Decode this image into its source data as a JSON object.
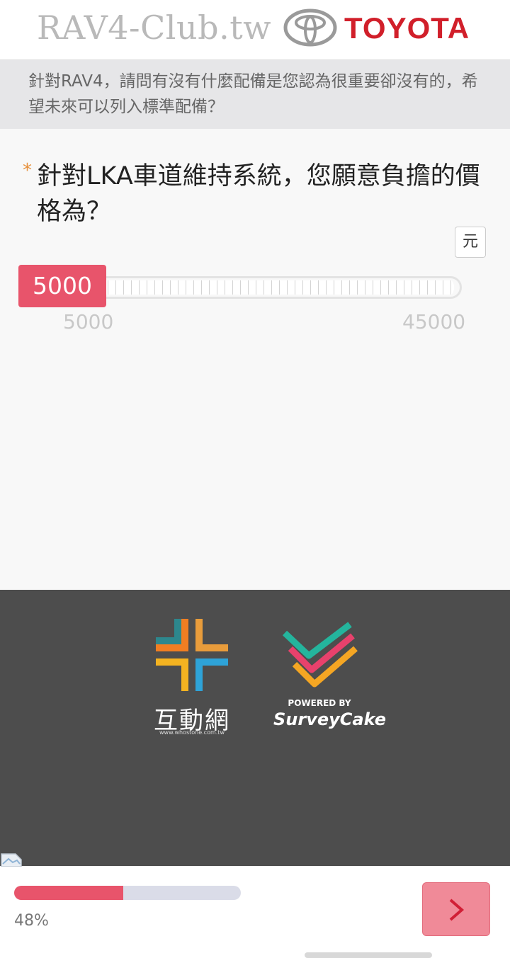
{
  "header": {
    "site_title": "RAV4-Club.tw",
    "brand": "TOYOTA",
    "brand_color": "#d11f2a"
  },
  "previous_question": {
    "text": "針對RAV4，請問有沒有什麼配備是您認為很重要卻沒有的，希望未來可以列入標準配備？"
  },
  "question": {
    "required_mark": "*",
    "text": "針對LKA車道維持系統，您願意負擔的價格為？",
    "unit": "元"
  },
  "slider": {
    "value": "5000",
    "min_label": "5000",
    "max_label": "45000",
    "accent_color": "#e8546b"
  },
  "footer": {
    "partner_name": "互動網",
    "partner_url": "www.whostone.com.tw",
    "powered_by": "POWERED BY",
    "platform": "SurveyCake"
  },
  "progress": {
    "percent_label": "48%",
    "fraction": 0.48
  },
  "navigation": {
    "next_icon": "chevron-right-icon"
  }
}
